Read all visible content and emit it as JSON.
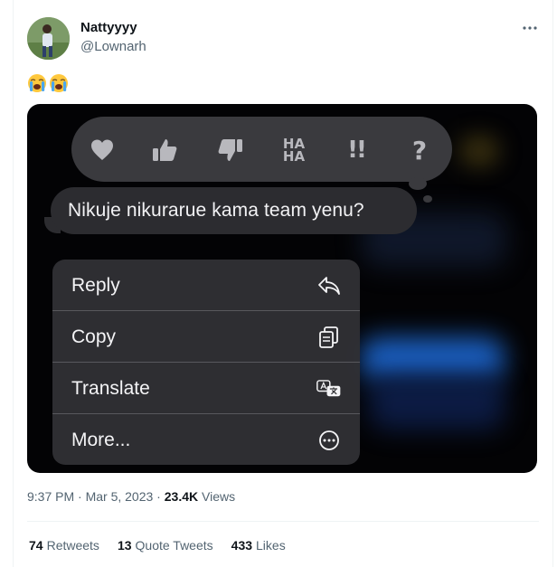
{
  "tweet": {
    "author_name": "Nattyyyy",
    "author_handle": "@Lownarh",
    "more_icon": "ellipsis-icon",
    "text_emojis": [
      "loudly-crying-face",
      "loudly-crying-face"
    ],
    "timestamp": "9:37 PM · Mar 5, 2023",
    "meta_sep": " · ",
    "views_count": "23.4K",
    "views_label": "Views",
    "stats": [
      {
        "count": "74",
        "label": "Retweets"
      },
      {
        "count": "13",
        "label": "Quote Tweets"
      },
      {
        "count": "433",
        "label": "Likes"
      }
    ]
  },
  "screenshot": {
    "reactions": [
      "heart-icon",
      "thumbs-up-icon",
      "thumbs-down-icon",
      "haha-icon",
      "exclamation-icon",
      "question-icon"
    ],
    "reaction_haha_top": "HA",
    "reaction_haha_bottom": "HA",
    "reaction_exclaim": "!!",
    "reaction_question": "?",
    "message_text": "Nikuje nikurarue kama team yenu?",
    "menu": [
      {
        "label": "Reply",
        "icon": "reply-icon"
      },
      {
        "label": "Copy",
        "icon": "copy-icon"
      },
      {
        "label": "Translate",
        "icon": "translate-icon"
      },
      {
        "label": "More...",
        "icon": "more-circle-icon"
      }
    ],
    "colors": {
      "background": "#030305",
      "bubble": "#2c2c30",
      "menu": "#303034",
      "accent_blur": "#1f6fe0"
    }
  }
}
